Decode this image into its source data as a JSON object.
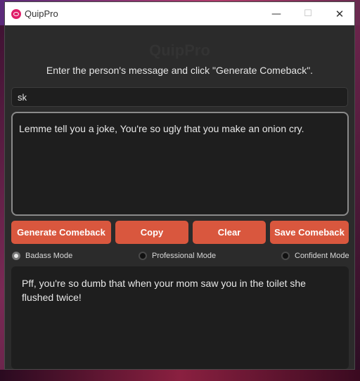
{
  "window": {
    "title": "QuipPro",
    "heading": "QuipPro",
    "controls": {
      "minimize": "—",
      "maximize": "☐",
      "close": "✕"
    }
  },
  "instruction": "Enter the person's message and click \"Generate Comeback\".",
  "name_input": {
    "value": "sk"
  },
  "message_box": {
    "text": "Lemme tell you a joke, You're so ugly that you make an onion cry."
  },
  "buttons": {
    "generate": "Generate Comeback",
    "copy": "Copy",
    "clear": "Clear",
    "save": "Save Comeback"
  },
  "modes": [
    {
      "label": "Badass Mode",
      "selected": true
    },
    {
      "label": "Professional Mode",
      "selected": false
    },
    {
      "label": "Confident Mode",
      "selected": false
    }
  ],
  "output": {
    "text": "Pff, you're so dumb that when your mom saw you in the toilet she flushed twice!"
  },
  "colors": {
    "button": "#d9573e",
    "background": "#2b2b2b",
    "field": "#1e1e1e",
    "app_icon": "#e0206a"
  }
}
